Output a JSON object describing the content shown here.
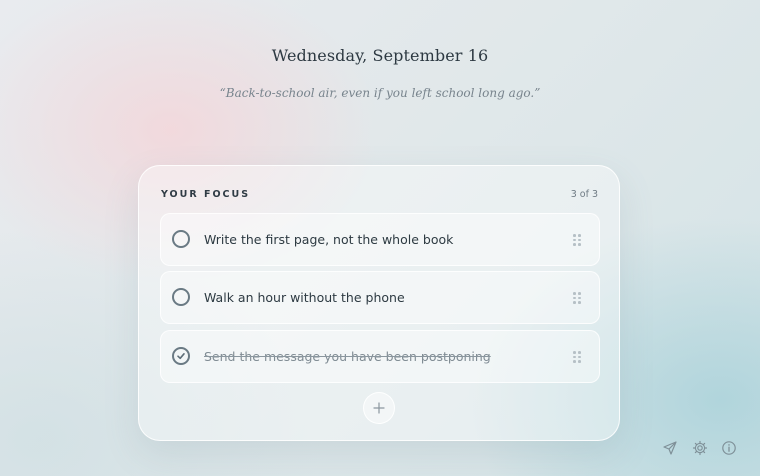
{
  "header": {
    "date": "Wednesday, September 16",
    "quote": "“Back-to-school air, even if you left school long ago.”"
  },
  "focus_card": {
    "title": "YOUR FOCUS",
    "count": "3 of 3",
    "tasks": [
      {
        "text": "Write the first page, not the whole book",
        "completed": false
      },
      {
        "text": "Walk an hour without the phone",
        "completed": false
      },
      {
        "text": "Send the message you have been postponing",
        "completed": true
      }
    ],
    "add_icon": "plus-icon"
  },
  "corner_icons": [
    "send-icon",
    "gear-icon",
    "info-icon"
  ],
  "colors": {
    "text_primary": "#2d3942",
    "text_muted": "#78848d",
    "check_stroke": "#6a7a84"
  }
}
